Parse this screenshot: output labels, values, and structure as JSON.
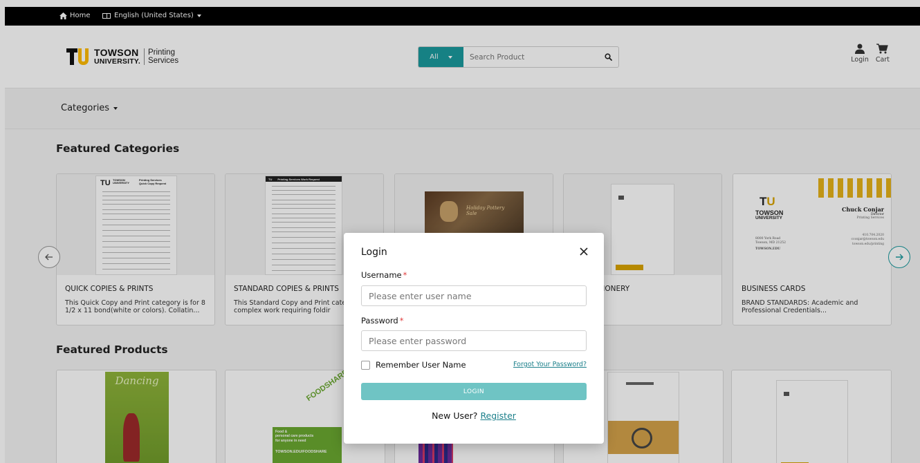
{
  "topbar": {
    "home_label": "Home",
    "language_label": "English (United States)"
  },
  "header": {
    "logo": {
      "line1": "TOWSON",
      "line2": "UNIVERSITY.",
      "service": "Printing Services"
    },
    "search": {
      "scope_label": "All",
      "placeholder": "Search Product"
    },
    "actions": {
      "login_label": "Login",
      "cart_label": "Cart"
    }
  },
  "catbar": {
    "categories_label": "Categories"
  },
  "featured_categories": {
    "title": "Featured Categories",
    "cards": [
      {
        "title": "QUICK COPIES & PRINTS",
        "desc": "This Quick Copy and Print category is for 8 1/2 x 11 bond(white or colors). Collatin..."
      },
      {
        "title": "STANDARD COPIES & PRINTS",
        "desc": " This Standard Copy and Print cate more complex work requiring foldir"
      },
      {
        "title": "",
        "desc": ""
      },
      {
        "title": "ITY STATIONERY",
        "desc": ""
      },
      {
        "title": "BUSINESS CARDS",
        "desc": "BRAND STANDARDS: Academic and Professional Credentials..."
      }
    ],
    "business_card": {
      "name": "Chuck Conjar",
      "role": "Director",
      "dept": "Printing Services",
      "logo1": "TOWSON",
      "logo2": "UNIVERSITY",
      "addr1": "8000 York Road",
      "addr2": "Towson, MD 21252",
      "phone": "410.704.2020",
      "email": "cconjar@towson.edu",
      "web": "towson.edu/printing",
      "site": "TOWSON.EDU"
    },
    "qc_doc": {
      "tu": "TU",
      "towson": "TOWSON",
      "univ": "UNIVERSITY",
      "head1": "Printing Services",
      "head2": "Quick Copy Request"
    },
    "swr_doc": {
      "tu": "TU",
      "head": "Printing Services Work Request"
    },
    "pottery_label": "Holiday Pottery Sale"
  },
  "featured_products": {
    "title": "Featured Products",
    "dancing_title": "Dancing",
    "foodshare_title": "FOODSHARE",
    "foodshare_lines": [
      "Food &",
      "personal care products",
      "for anyone in need"
    ],
    "foodshare_url": "TOWSON.EDU/FOODSHARE",
    "foodshare_tu": "TU"
  },
  "login_modal": {
    "title": "Login",
    "username_label": "Username",
    "username_placeholder": "Please enter user name",
    "password_label": "Password",
    "password_placeholder": "Please enter password",
    "required_mark": "*",
    "remember_label": "Remember User Name",
    "forgot_label": "Forgot Your Password?",
    "login_button": "LOGIN",
    "new_user_text": "New User?",
    "register_label": "Register"
  },
  "colors": {
    "accent": "#1b9a9e",
    "login_button": "#6fc4c4",
    "link": "#1b7f8a",
    "brand_gold": "#ffbb00",
    "required": "#e03a3a"
  }
}
